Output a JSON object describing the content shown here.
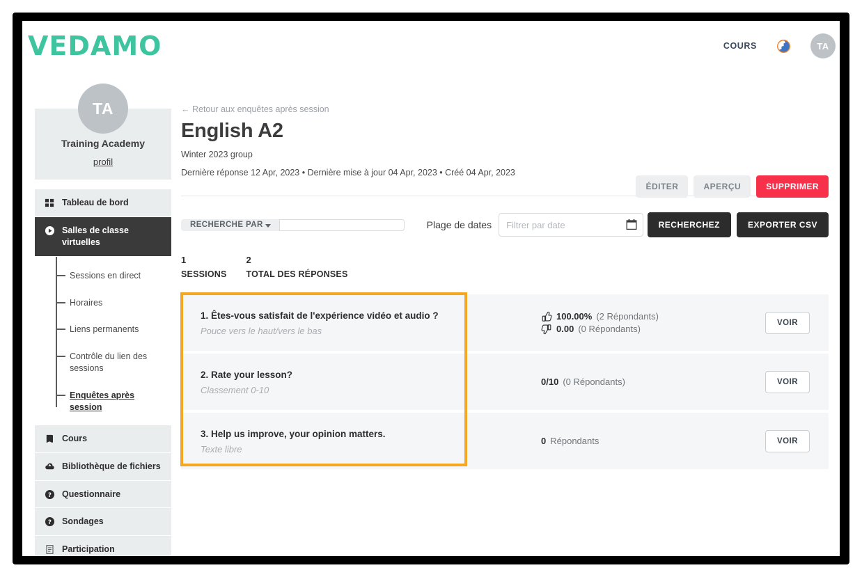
{
  "header": {
    "logo_text": "VEDAMO",
    "nav_link": "COURS",
    "globe_icon": "globe-icon",
    "avatar_initials": "TA"
  },
  "sidebar": {
    "profile": {
      "avatar_initials": "TA",
      "name": "Training Academy",
      "profile_link": "profil"
    },
    "items": [
      {
        "label": "Tableau de bord",
        "icon": "grid-icon",
        "active": false
      },
      {
        "label": "Salles de classe virtuelles",
        "icon": "play-circle-icon",
        "active": true
      }
    ],
    "subitems": [
      {
        "label": "Sessions en direct",
        "current": false
      },
      {
        "label": "Horaires",
        "current": false
      },
      {
        "label": "Liens permanents",
        "current": false
      },
      {
        "label": "Contrôle du lien des sessions",
        "current": false
      },
      {
        "label": "Enquêtes après session",
        "current": true
      }
    ],
    "items_lower": [
      {
        "label": "Cours",
        "icon": "book-icon"
      },
      {
        "label": "Bibliothèque de fichiers",
        "icon": "cloud-icon"
      },
      {
        "label": "Questionnaire",
        "icon": "question-circle-icon"
      },
      {
        "label": "Sondages",
        "icon": "question-circle-icon"
      },
      {
        "label": "Participation",
        "icon": "document-icon"
      }
    ]
  },
  "main": {
    "back_link": "← Retour aux enquêtes après session",
    "title": "English A2",
    "subtitle": "Winter 2023 group",
    "meta": "Dernière réponse 12 Apr, 2023 • Dernière mise à jour 04 Apr, 2023 • Créé 04 Apr, 2023",
    "actions": {
      "edit": "ÉDITER",
      "preview": "APERÇU",
      "delete": "SUPPRIMER"
    },
    "filters": {
      "search_by_label": "RECHERCHE PAR",
      "search_value": "",
      "search_placeholder": "",
      "date_range_label": "Plage de dates",
      "date_value": "",
      "date_placeholder": "Filtrer par date",
      "calendar_icon": "calendar-icon",
      "search_button": "RECHERCHEZ",
      "export_button": "EXPORTER CSV"
    },
    "stats": [
      {
        "number": "1",
        "label": "SESSIONS"
      },
      {
        "number": "2",
        "label": "TOTAL DES RÉPONSES"
      }
    ],
    "view_button": "VOIR",
    "questions": [
      {
        "title": "1. Êtes-vous satisfait de l'expérience vidéo et audio ?",
        "type": "Pouce vers le haut/vers le bas",
        "results": [
          {
            "icon": "thumbs-up-icon",
            "value": "100.00%",
            "sub": "(2 Répondants)"
          },
          {
            "icon": "thumbs-down-icon",
            "value": "0.00",
            "sub": "(0 Répondants)"
          }
        ]
      },
      {
        "title": "2. Rate your lesson?",
        "type": "Classement 0-10",
        "results": [
          {
            "icon": "none",
            "value": "0/10",
            "sub": "(0 Répondants)"
          }
        ]
      },
      {
        "title": "3. Help us improve, your opinion matters.",
        "type": "Texte libre",
        "results": [
          {
            "icon": "none",
            "value": "0",
            "sub": "Répondants"
          }
        ]
      }
    ]
  },
  "colors": {
    "brand_teal": "#3fc4a0",
    "danger_red": "#f8314b",
    "highlight_orange": "#f5a623",
    "dark": "#2c2c2c"
  }
}
